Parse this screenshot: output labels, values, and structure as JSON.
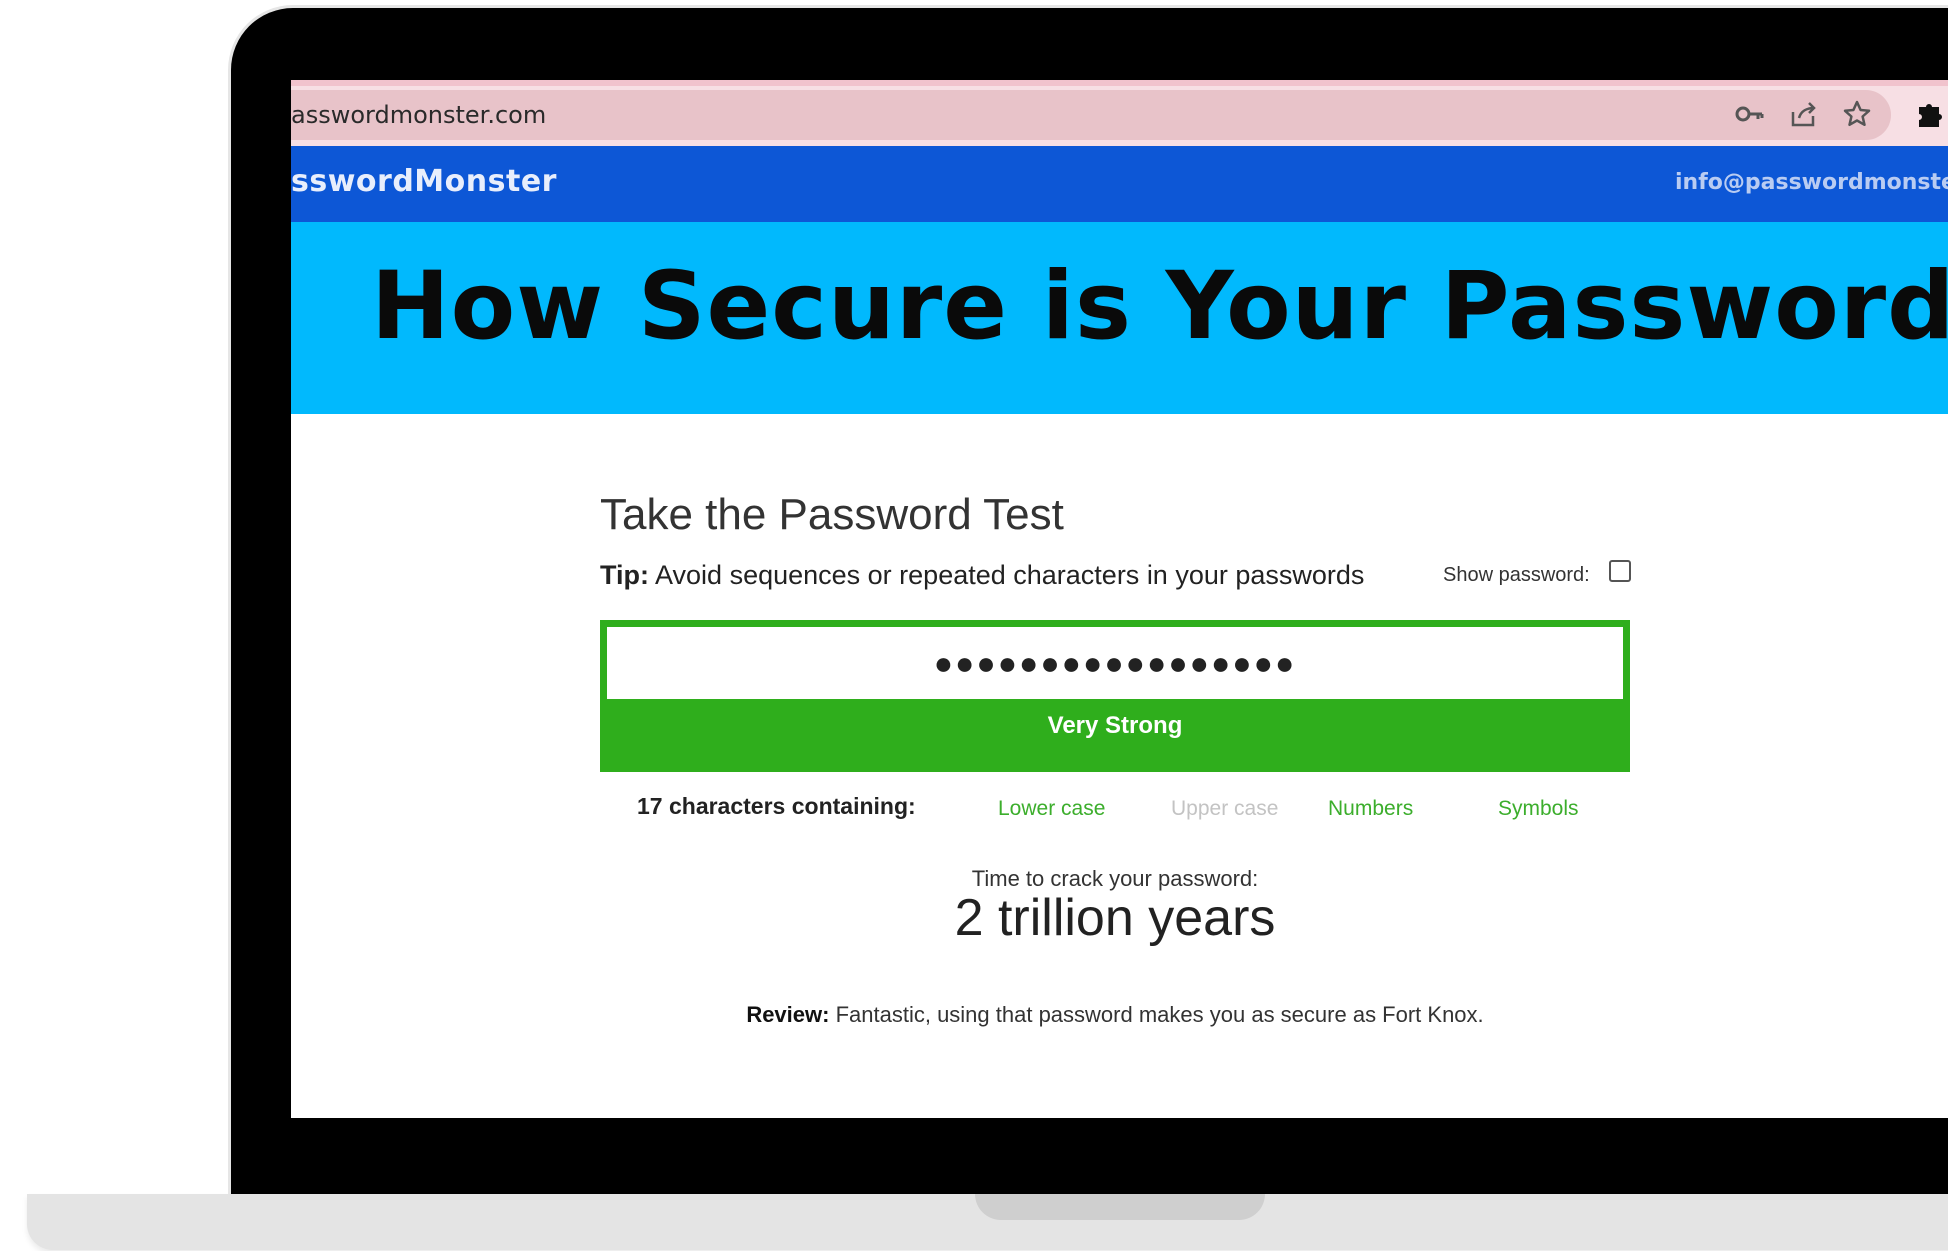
{
  "browser": {
    "url": "asswordmonster.com",
    "icons": [
      "key-icon",
      "share-icon",
      "star-icon",
      "extension-icon"
    ]
  },
  "site": {
    "brand": "sswordMonster",
    "email": "info@passwordmonster.co",
    "header_color": "#0d57d6"
  },
  "hero": {
    "title": "How Secure is Your Password?",
    "background": "#01b9fd"
  },
  "test": {
    "title": "Take the Password Test",
    "tip_label": "Tip:",
    "tip_text": " Avoid sequences or repeated characters in your passwords",
    "show_password_label": "Show password:",
    "show_password_checked": false,
    "password_masked": "●●●●●●●●●●●●●●●●●",
    "strength": "Very Strong",
    "strength_color": "#2fae1c",
    "chars_summary": "17 characters containing:",
    "checks": [
      {
        "label": "Lower case",
        "active": true
      },
      {
        "label": "Upper case",
        "active": false
      },
      {
        "label": "Numbers",
        "active": true
      },
      {
        "label": "Symbols",
        "active": true
      }
    ],
    "active_color": "#3cae2c",
    "inactive_color": "#c3c3c3",
    "crack_label": "Time to crack your password:",
    "crack_value": "2 trillion years",
    "review_label": "Review:",
    "review_text": " Fantastic, using that password makes you as secure as Fort Knox."
  }
}
